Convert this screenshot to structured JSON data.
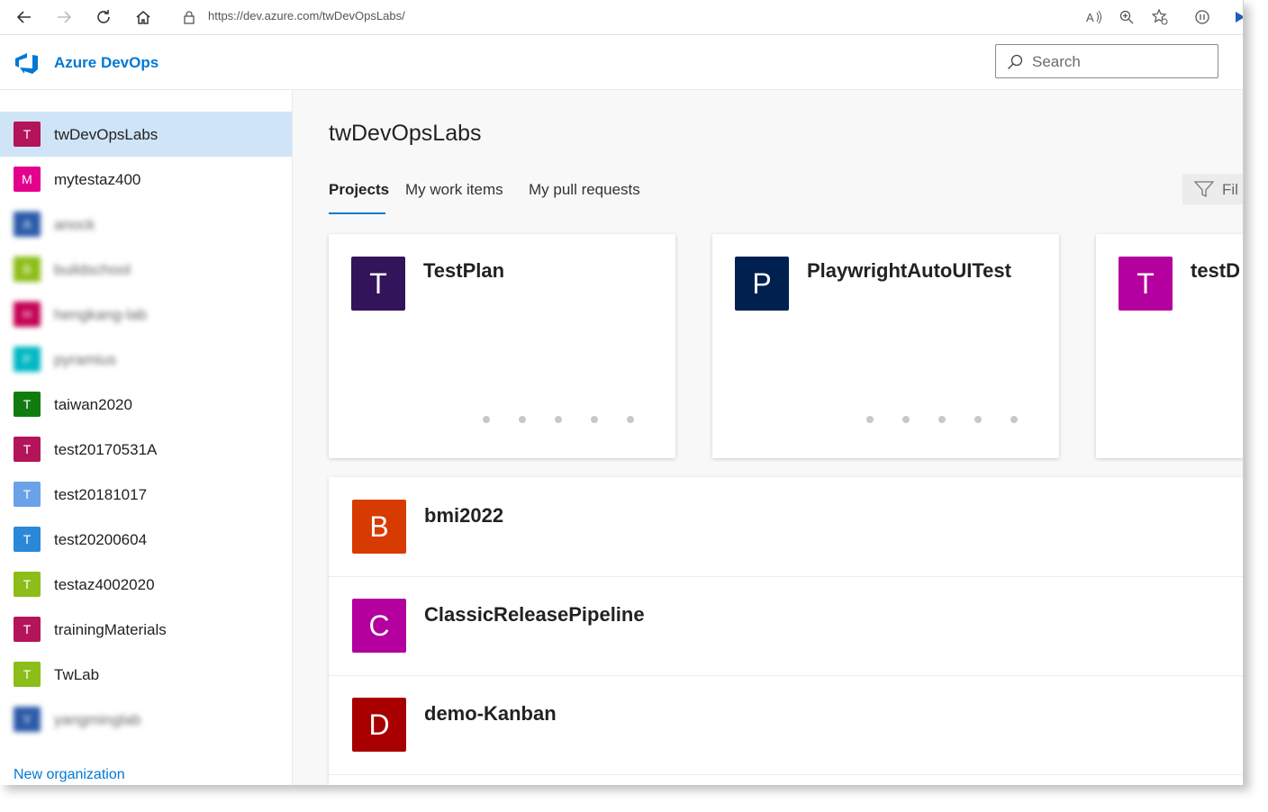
{
  "browser": {
    "url": "https://dev.azure.com/twDevOpsLabs/"
  },
  "header": {
    "brand": "Azure DevOps",
    "search_placeholder": "Search"
  },
  "sidebar": {
    "orgs": [
      {
        "initial": "T",
        "name": "twDevOpsLabs",
        "color": "#b4145a",
        "selected": true,
        "blurred": false
      },
      {
        "initial": "M",
        "name": "mytestaz400",
        "color": "#e3008c",
        "selected": false,
        "blurred": false
      },
      {
        "initial": "A",
        "name": "anock",
        "color": "#2b5aa8",
        "selected": false,
        "blurred": true
      },
      {
        "initial": "B",
        "name": "buildschool",
        "color": "#8cbd18",
        "selected": false,
        "blurred": true
      },
      {
        "initial": "H",
        "name": "hengkang-lab",
        "color": "#c30052",
        "selected": false,
        "blurred": true
      },
      {
        "initial": "P",
        "name": "pyramius",
        "color": "#00b7c3",
        "selected": false,
        "blurred": true
      },
      {
        "initial": "T",
        "name": "taiwan2020",
        "color": "#107c10",
        "selected": false,
        "blurred": false
      },
      {
        "initial": "T",
        "name": "test20170531A",
        "color": "#b4145a",
        "selected": false,
        "blurred": false
      },
      {
        "initial": "T",
        "name": "test20181017",
        "color": "#6ba1e6",
        "selected": false,
        "blurred": false
      },
      {
        "initial": "T",
        "name": "test20200604",
        "color": "#2b88d8",
        "selected": false,
        "blurred": false
      },
      {
        "initial": "T",
        "name": "testaz4002020",
        "color": "#8cbd18",
        "selected": false,
        "blurred": false
      },
      {
        "initial": "T",
        "name": "trainingMaterials",
        "color": "#b4145a",
        "selected": false,
        "blurred": false
      },
      {
        "initial": "T",
        "name": "TwLab",
        "color": "#8cbd18",
        "selected": false,
        "blurred": false
      },
      {
        "initial": "Y",
        "name": "yangminglab",
        "color": "#2b5aa8",
        "selected": false,
        "blurred": true
      }
    ],
    "new_org_label": "New organization"
  },
  "main": {
    "title": "twDevOpsLabs",
    "tabs": [
      {
        "label": "Projects",
        "active": true
      },
      {
        "label": "My work items",
        "active": false
      },
      {
        "label": "My pull requests",
        "active": false
      }
    ],
    "filter_label": "Fil",
    "cards": [
      {
        "initial": "T",
        "name": "TestPlan",
        "color": "#32145a"
      },
      {
        "initial": "P",
        "name": "PlaywrightAutoUITest",
        "color": "#002050"
      },
      {
        "initial": "T",
        "name": "testD",
        "color": "#b4009e"
      }
    ],
    "projects": [
      {
        "initial": "B",
        "name": "bmi2022",
        "color": "#d83b01"
      },
      {
        "initial": "C",
        "name": "ClassicReleasePipeline",
        "color": "#b4009e"
      },
      {
        "initial": "D",
        "name": "demo-Kanban",
        "color": "#a80000"
      }
    ]
  }
}
